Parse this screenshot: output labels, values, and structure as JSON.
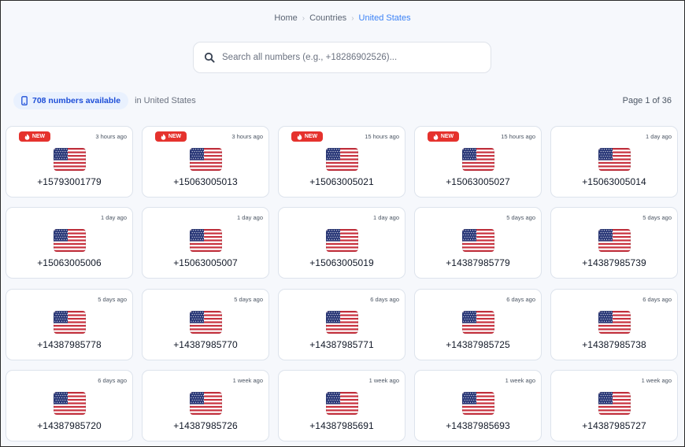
{
  "breadcrumb": {
    "items": [
      "Home",
      "Countries",
      "United States"
    ]
  },
  "search": {
    "placeholder": "Search all numbers (e.g., +18286902526)..."
  },
  "summary": {
    "count_label": "708 numbers available",
    "country_label": "in United States",
    "page_label": "Page 1 of 36"
  },
  "cards": [
    {
      "number": "+15793001779",
      "time": "3 hours ago",
      "new": true,
      "new_label": "NEW"
    },
    {
      "number": "+15063005013",
      "time": "3 hours ago",
      "new": true,
      "new_label": "NEW"
    },
    {
      "number": "+15063005021",
      "time": "15 hours ago",
      "new": true,
      "new_label": "NEW"
    },
    {
      "number": "+15063005027",
      "time": "15 hours ago",
      "new": true,
      "new_label": "NEW"
    },
    {
      "number": "+15063005014",
      "time": "1 day ago",
      "new": false
    },
    {
      "number": "+15063005006",
      "time": "1 day ago",
      "new": false
    },
    {
      "number": "+15063005007",
      "time": "1 day ago",
      "new": false
    },
    {
      "number": "+15063005019",
      "time": "1 day ago",
      "new": false
    },
    {
      "number": "+14387985779",
      "time": "5 days ago",
      "new": false
    },
    {
      "number": "+14387985739",
      "time": "5 days ago",
      "new": false
    },
    {
      "number": "+14387985778",
      "time": "5 days ago",
      "new": false
    },
    {
      "number": "+14387985770",
      "time": "5 days ago",
      "new": false
    },
    {
      "number": "+14387985771",
      "time": "6 days ago",
      "new": false
    },
    {
      "number": "+14387985725",
      "time": "6 days ago",
      "new": false
    },
    {
      "number": "+14387985738",
      "time": "6 days ago",
      "new": false
    },
    {
      "number": "+14387985720",
      "time": "6 days ago",
      "new": false
    },
    {
      "number": "+14387985726",
      "time": "1 week ago",
      "new": false
    },
    {
      "number": "+14387985691",
      "time": "1 week ago",
      "new": false
    },
    {
      "number": "+14387985693",
      "time": "1 week ago",
      "new": false
    },
    {
      "number": "+14387985727",
      "time": "1 week ago",
      "new": false
    }
  ],
  "icons": {
    "search": "search-icon",
    "phone": "phone-icon",
    "new": "fire-icon",
    "flag": "us-flag-icon"
  },
  "colors": {
    "accent": "#3b82f6",
    "badge_bg": "#e9f1fe",
    "new_badge": "#e5322d",
    "page_bg": "#f6f8fc"
  }
}
